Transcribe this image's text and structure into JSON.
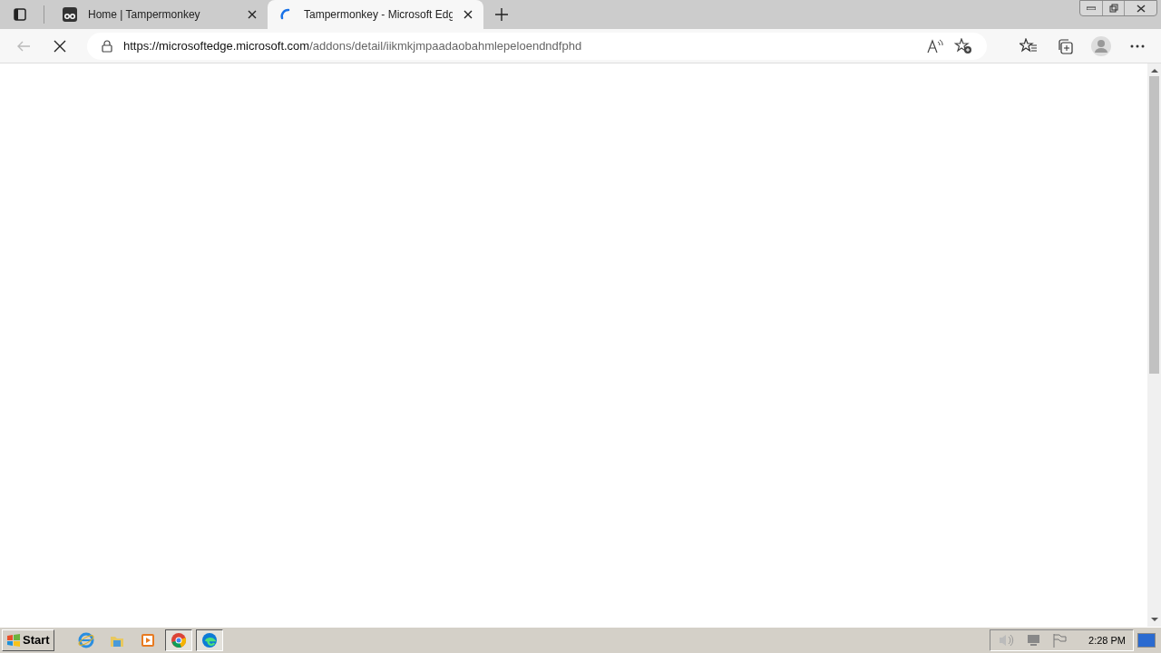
{
  "tabs": [
    {
      "kind": "site",
      "title": "Home | Tampermonkey",
      "selected": false
    },
    {
      "kind": "loading",
      "title": "Tampermonkey - Microsoft Edg",
      "selected": true
    }
  ],
  "address_bar": {
    "url_host": "https://microsoftedge.microsoft.com",
    "url_path": "/addons/detail/iikmkjmpaadaobahmlepeloendndfphd"
  },
  "taskbar": {
    "start_label": "Start",
    "apps": [
      {
        "kind": "ie",
        "selected": false
      },
      {
        "kind": "folder",
        "selected": false
      },
      {
        "kind": "media",
        "selected": false
      },
      {
        "kind": "chrome",
        "selected": true
      },
      {
        "kind": "edge",
        "selected": true
      }
    ],
    "clock": "2:28 PM"
  }
}
